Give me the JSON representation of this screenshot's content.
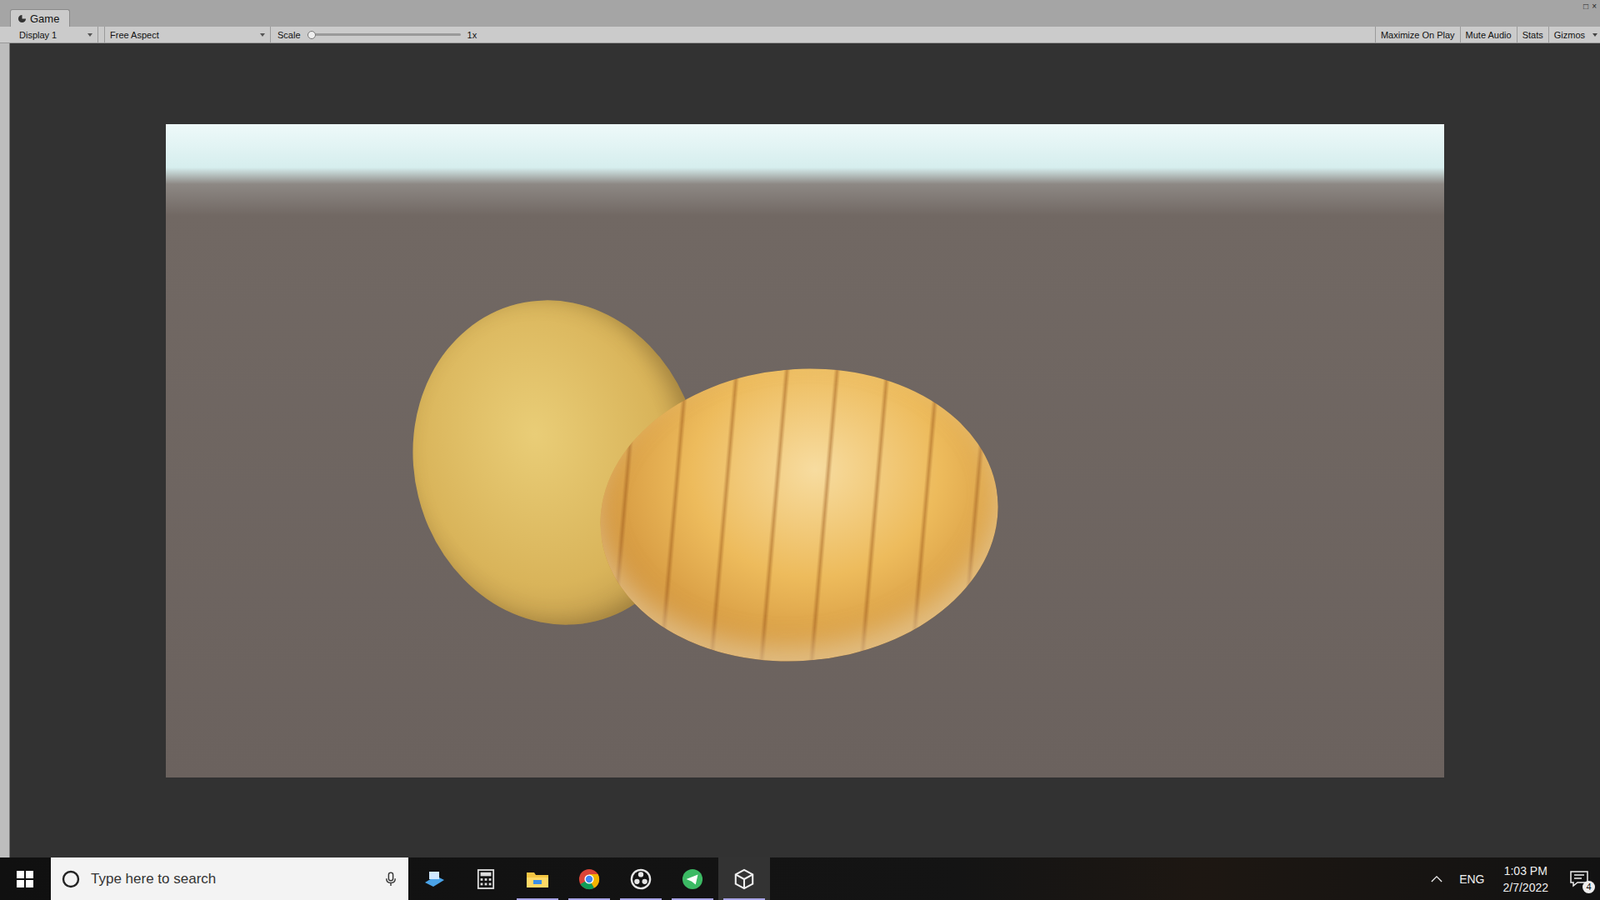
{
  "window": {
    "title": "Game",
    "controls": [
      "□",
      "×"
    ]
  },
  "tabs": [
    {
      "label": "Game",
      "selected": true
    }
  ],
  "toolbar": {
    "display": "Display 1",
    "aspect": "Free Aspect",
    "scale": {
      "label": "Scale",
      "value": "1x",
      "level": 0
    },
    "toggles": [
      {
        "label": "Maximize On Play",
        "on": false
      },
      {
        "label": "Mute Audio",
        "on": false
      },
      {
        "label": "Stats",
        "on": false
      },
      {
        "label": "Gizmos",
        "on": false
      }
    ]
  },
  "taskbar": {
    "search": {
      "placeholder": "Type here to search"
    },
    "apps": [
      {
        "kind": "desktop",
        "running": false,
        "selected": false
      },
      {
        "kind": "calculator",
        "running": false,
        "selected": false
      },
      {
        "kind": "files",
        "running": true,
        "selected": false
      },
      {
        "kind": "chrome",
        "running": true,
        "selected": false
      },
      {
        "kind": "obs",
        "running": true,
        "selected": false
      },
      {
        "kind": "telegram",
        "running": true,
        "selected": false
      },
      {
        "kind": "unity",
        "running": true,
        "selected": true
      }
    ],
    "tray": {
      "language": "ENG",
      "time": "1:03 PM",
      "date": "2/7/2022",
      "notifications": "4"
    }
  }
}
